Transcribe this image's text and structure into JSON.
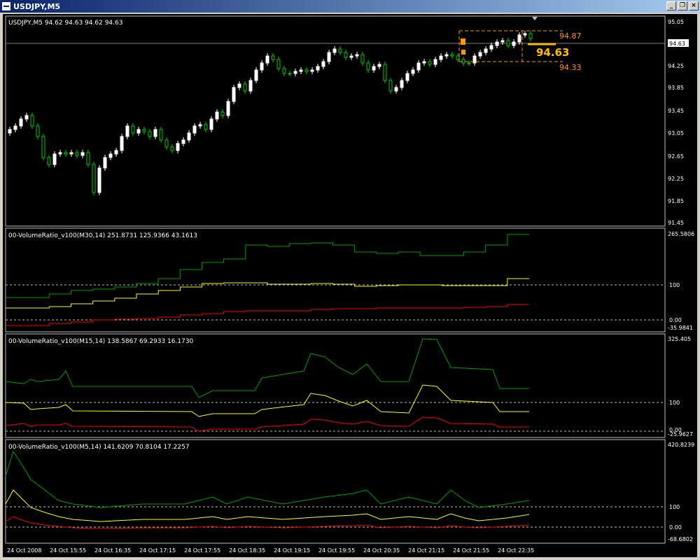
{
  "window": {
    "title": "USDJPY,M5"
  },
  "main": {
    "header": "USDJPY,M5  94.62 94.63 94.62 94.63",
    "price_ticks": [
      "95.05",
      "94.63",
      "94.25",
      "93.85",
      "93.45",
      "93.05",
      "92.65",
      "92.25",
      "91.85",
      "91.45"
    ],
    "current_price_tag": "94.63",
    "range_high": "94.87",
    "range_low": "94.33",
    "big_price": "94.63",
    "colors": {
      "bull": "#ffffff",
      "bear": "#00cc00",
      "range": "#ff9900",
      "big": "#ffc000"
    }
  },
  "indicators": [
    {
      "header": "00-VolumeRatio_v100(M30,14) 251.8731 125.9366 43.1613",
      "ticks": [
        "265.5806",
        "100",
        "0.00",
        "-35.9841"
      ]
    },
    {
      "header": "00-VolumeRatio_v100(M15,14) 138.5867 69.2933 16.1730",
      "ticks": [
        "325.405",
        "100",
        "0.00",
        "-25.9627"
      ]
    },
    {
      "header": "00-VolumeRatio_v100(M5,14) 141.6209 70.8104 17.2257",
      "ticks": [
        "420.8239",
        "100",
        "0.00",
        "-68.6802"
      ]
    }
  ],
  "time_axis": [
    "24 Oct 2008",
    "24 Oct 15:55",
    "24 Oct 16:35",
    "24 Oct 17:15",
    "24 Oct 17:55",
    "24 Oct 18:35",
    "24 Oct 19:15",
    "24 Oct 19:55",
    "24 Oct 20:35",
    "24 Oct 21:15",
    "24 Oct 21:55",
    "24 Oct 22:35"
  ],
  "line_colors": {
    "upper": "#00a000",
    "middle": "#ffff00",
    "lower": "#ff0000"
  }
}
